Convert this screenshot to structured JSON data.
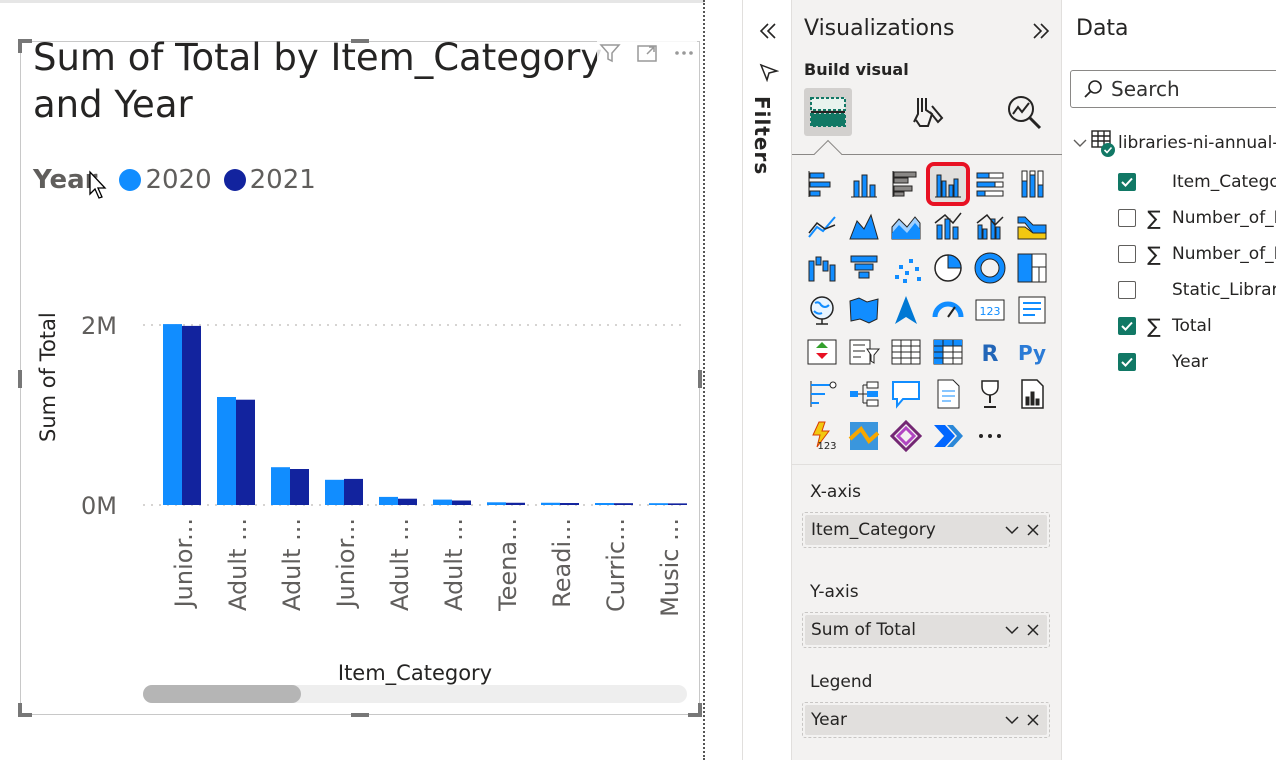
{
  "visual": {
    "title": "Sum of Total by Item_Category and Year",
    "header_icons": [
      "filter-icon",
      "focus-mode-icon",
      "more-options-icon"
    ],
    "legend": {
      "title": "Year",
      "items": [
        {
          "label": "2020",
          "color": "#118dff"
        },
        {
          "label": "2021",
          "color": "#12239e"
        }
      ]
    }
  },
  "chart_data": {
    "type": "bar",
    "title": "Sum of Total by Item_Category and Year",
    "xlabel": "Item_Category",
    "ylabel": "Sum of Total",
    "y_ticks": [
      "2M",
      "0M"
    ],
    "ylim": [
      0,
      2000000
    ],
    "grid": true,
    "legend_position": "top-left",
    "categories": [
      "Junior...",
      "Adult ...",
      "Adult ...",
      "Junior...",
      "Adult ...",
      "Adult ...",
      "Teena...",
      "Readi...",
      "Curric...",
      "Music ..."
    ],
    "series": [
      {
        "name": "2020",
        "color": "#118dff",
        "values": [
          2010000,
          1200000,
          420000,
          280000,
          90000,
          60000,
          30000,
          25000,
          22000,
          20000
        ]
      },
      {
        "name": "2021",
        "color": "#12239e",
        "values": [
          1990000,
          1170000,
          400000,
          290000,
          70000,
          50000,
          25000,
          22000,
          20000,
          18000
        ]
      }
    ]
  },
  "filters": {
    "label": "Filters"
  },
  "visualizations": {
    "title": "Visualizations",
    "build_label": "Build visual",
    "icons": [
      "stacked-bar-chart-icon",
      "stacked-column-chart-icon",
      "clustered-bar-chart-icon",
      "clustered-column-chart-icon",
      "100-stacked-bar-chart-icon",
      "100-stacked-column-chart-icon",
      "line-chart-icon",
      "area-chart-icon",
      "stacked-area-chart-icon",
      "line-and-stacked-column-chart-icon",
      "line-and-clustered-column-chart-icon",
      "ribbon-chart-icon",
      "waterfall-chart-icon",
      "funnel-chart-icon",
      "scatter-chart-icon",
      "pie-chart-icon",
      "donut-chart-icon",
      "treemap-icon",
      "map-icon",
      "filled-map-icon",
      "azure-map-icon",
      "gauge-icon",
      "card-icon",
      "multi-row-card-icon",
      "kpi-icon",
      "slicer-icon",
      "table-icon",
      "matrix-icon",
      "r-visual-icon",
      "python-visual-icon",
      "key-influencers-icon",
      "decomposition-tree-icon",
      "qa-icon",
      "smart-narrative-icon",
      "metrics-icon",
      "paginated-report-icon",
      "new-card-icon",
      "arcgis-map-icon",
      "power-apps-icon",
      "power-automate-icon",
      "more-visuals-icon"
    ],
    "selected_icon": "clustered-column-chart-icon",
    "wells": [
      {
        "label": "X-axis",
        "value": "Item_Category"
      },
      {
        "label": "Y-axis",
        "value": "Sum of Total"
      },
      {
        "label": "Legend",
        "value": "Year"
      }
    ]
  },
  "data": {
    "title": "Data",
    "search_placeholder": "Search",
    "table_name": "libraries-ni-annual-",
    "fields": [
      {
        "name": "Item_Catego",
        "checked": true,
        "sigma": false
      },
      {
        "name": "Number_of_I",
        "checked": false,
        "sigma": true
      },
      {
        "name": "Number_of_I",
        "checked": false,
        "sigma": true
      },
      {
        "name": "Static_Library",
        "checked": false,
        "sigma": false
      },
      {
        "name": "Total",
        "checked": true,
        "sigma": true
      },
      {
        "name": "Year",
        "checked": true,
        "sigma": false
      }
    ]
  }
}
